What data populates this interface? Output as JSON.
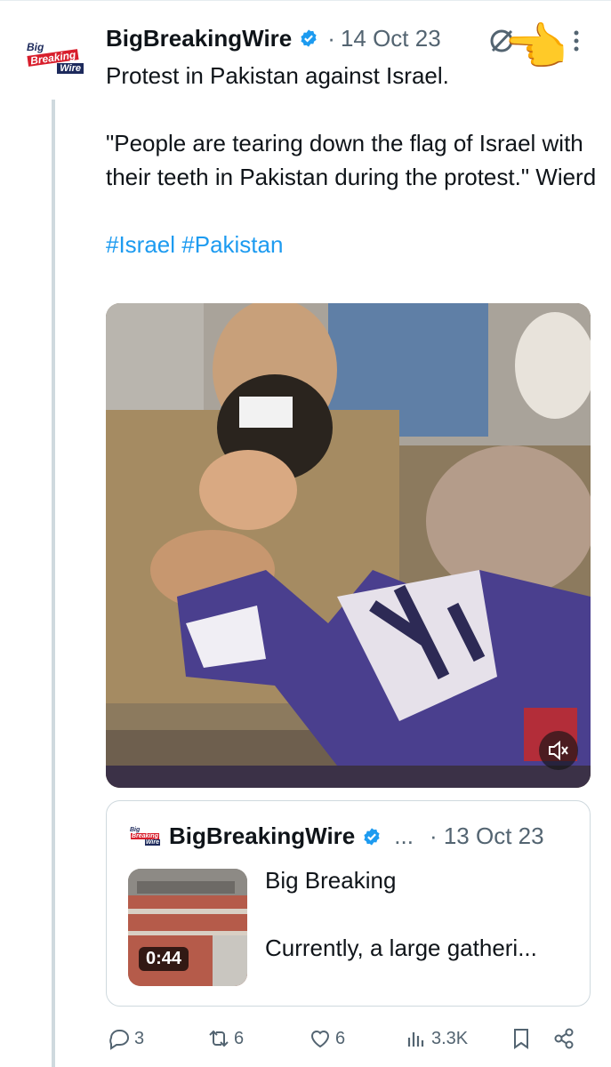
{
  "tweet": {
    "avatar": {
      "line1": "Big",
      "line2": "Breaking",
      "line3": "Wire"
    },
    "author": "BigBreakingWire",
    "separator": "·",
    "date": "14 Oct 23",
    "text_line1": "Protest in Pakistan against Israel.",
    "text_quote": "\"People are tearing down the flag of Israel with their teeth in Pakistan during the protest.\" Wierd",
    "hashtags": "#Israel #Pakistan",
    "hand_emoji": "👈"
  },
  "quoted": {
    "avatar": {
      "line1": "Big",
      "line2": "Breaking",
      "line3": "Wire"
    },
    "author": "BigBreakingWire",
    "ellipsis": "...",
    "separator": "·",
    "date": "13 Oct 23",
    "video_duration": "0:44",
    "headline": "Big Breaking",
    "snippet": "Currently, a large gatheri..."
  },
  "actions": {
    "replies": "3",
    "reposts": "6",
    "likes": "6",
    "views": "3.3K"
  },
  "colors": {
    "accent": "#1d9bf0",
    "muted": "#536471",
    "border": "#cfd9de",
    "thread_line": "#cfd9de"
  },
  "icons": [
    "verified-badge-icon",
    "grok-icon",
    "more-icon",
    "mute-icon",
    "reply-icon",
    "repost-icon",
    "like-icon",
    "views-icon",
    "bookmark-icon",
    "share-icon"
  ]
}
